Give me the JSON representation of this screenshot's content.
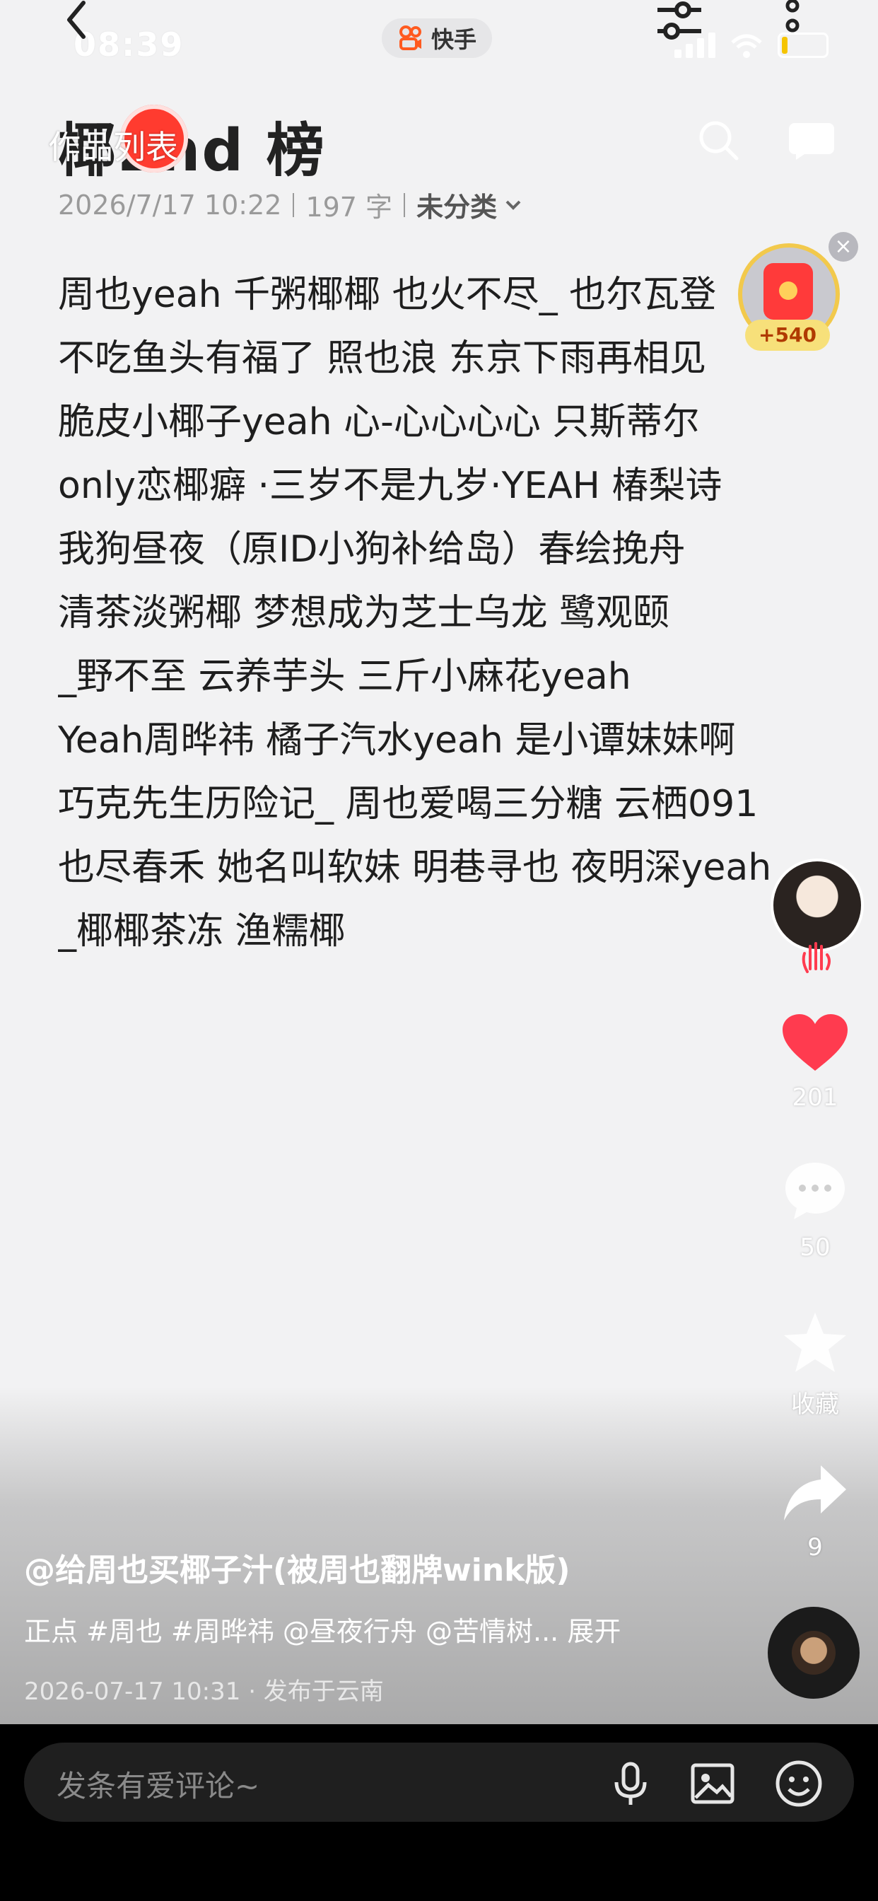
{
  "status": {
    "time": "08:39"
  },
  "top_bar": {
    "app_name": "快手"
  },
  "header": {
    "title": "椰2nd 榜",
    "works_label": "作品列表",
    "date": "2026/7/17 10:22",
    "word_count": "197 字",
    "category": "未分类"
  },
  "note_lines": [
    "周也yeah  千粥椰椰  也火不尽_  也尔瓦登",
    "不吃鱼头有福了  照也浪  东京下雨再相见",
    "脆皮小椰子yeah  心-心心心心  只斯蒂尔",
    "only恋椰癖  ·三岁不是九岁·YEAH  椿梨诗",
    "我狗昼夜（原ID小狗补给岛）春绘挽舟",
    "清茶淡粥椰  梦想成为芝士乌龙  鹭观颐",
    "_野不至   云养芋头   三斤小麻花yeah",
    "Yeah周晔祎  橘子汽水yeah  是小谭妹妹啊",
    "巧克先生历险记_  周也爱喝三分糖  云栖091",
    "也尽春禾 她名叫软妹  明巷寻也 夜明深yeah",
    " _椰椰茶冻 渔糯椰"
  ],
  "red_packet": {
    "amount": "+540"
  },
  "rail": {
    "likes": "201",
    "comments": "50",
    "favorite_label": "收藏",
    "shares": "9"
  },
  "caption": {
    "author": "@给周也买椰子汁(被周也翻牌wink版)",
    "tags": "正点 #周也 #周晔祎 @昼夜行舟 @苦情树... 展开",
    "date_location": "2026-07-17 10:31 · 发布于云南"
  },
  "comment_bar": {
    "placeholder": "发条有爱评论~"
  },
  "colors": {
    "like": "#ff3b4f",
    "accent": "#ff5a1f",
    "bar_bg": "#000000"
  }
}
